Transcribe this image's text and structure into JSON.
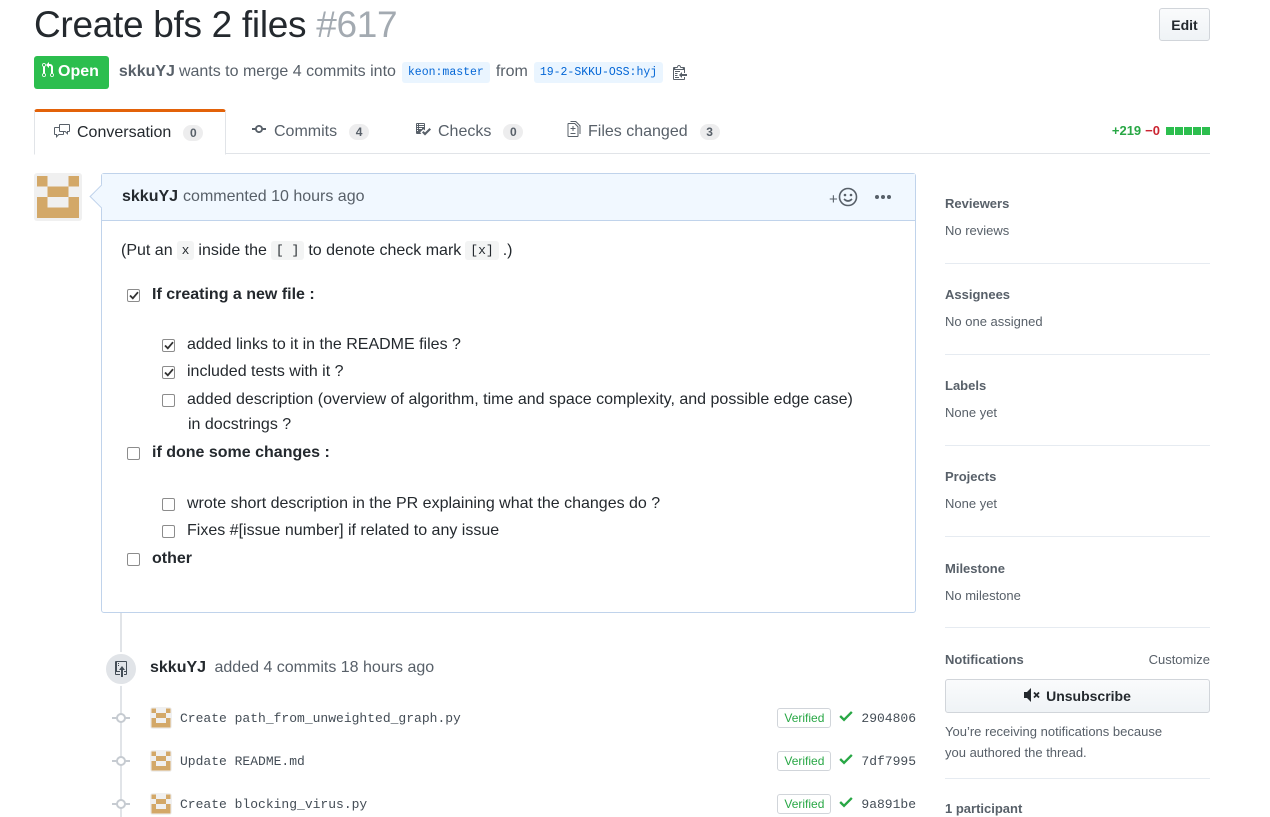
{
  "pr": {
    "title": "Create bfs 2 files",
    "number": "#617",
    "edit_label": "Edit",
    "state": "Open",
    "author": "skkuYJ",
    "merge_text": "wants to merge 4 commits into",
    "base_branch": "keon:master",
    "from_text": "from",
    "head_branch": "19-2-SKKU-OSS:hyj"
  },
  "tabs": [
    {
      "label": "Conversation",
      "count": "0",
      "icon": "comment-discussion-icon"
    },
    {
      "label": "Commits",
      "count": "4",
      "icon": "git-commit-icon"
    },
    {
      "label": "Checks",
      "count": "0",
      "icon": "checklist-icon"
    },
    {
      "label": "Files changed",
      "count": "3",
      "icon": "file-diff-icon"
    }
  ],
  "diffstat": {
    "additions": "+219",
    "deletions": "−0"
  },
  "comment": {
    "author": "skkuYJ",
    "action": "commented",
    "time": "10 hours ago",
    "intro_prefix": "(Put an",
    "intro_code1": "x",
    "intro_mid": "inside the",
    "intro_code2": "[ ]",
    "intro_mid2": "to denote check mark",
    "intro_code3": "[x]",
    "intro_suffix": ".)",
    "items": [
      {
        "text": "If creating a new file :",
        "checked": true,
        "bold": true
      },
      {
        "text": "added links to it in the README files ?",
        "checked": true,
        "bold": false
      },
      {
        "text": "included tests with it ?",
        "checked": true,
        "bold": false
      },
      {
        "text": "added description (overview of algorithm, time and space complexity, and possible edge case)",
        "text2": "in docstrings ?",
        "checked": false,
        "bold": false
      },
      {
        "text": "if done some changes :",
        "checked": false,
        "bold": true
      },
      {
        "text": "wrote short description in the PR explaining what the changes do ?",
        "checked": false,
        "bold": false
      },
      {
        "text": "Fixes #[issue number] if related to any issue",
        "checked": false,
        "bold": false
      },
      {
        "text": "other",
        "checked": false,
        "bold": true
      }
    ]
  },
  "push_event": {
    "author": "skkuYJ",
    "text": "added 4 commits 18 hours ago"
  },
  "commits": [
    {
      "message": "Create path_from_unweighted_graph.py",
      "verified": "Verified",
      "sha": "2904806"
    },
    {
      "message": "Update README.md",
      "verified": "Verified",
      "sha": "7df7995"
    },
    {
      "message": "Create blocking_virus.py",
      "verified": "Verified",
      "sha": "9a891be"
    }
  ],
  "sidebar": {
    "reviewers": {
      "heading": "Reviewers",
      "value": "No reviews"
    },
    "assignees": {
      "heading": "Assignees",
      "value": "No one assigned"
    },
    "labels": {
      "heading": "Labels",
      "value": "None yet"
    },
    "projects": {
      "heading": "Projects",
      "value": "None yet"
    },
    "milestone": {
      "heading": "Milestone",
      "value": "No milestone"
    },
    "notifications": {
      "heading": "Notifications",
      "customize": "Customize",
      "button": "Unsubscribe",
      "note_line1": "You’re receiving notifications because",
      "note_line2": "you authored the thread."
    },
    "participants": {
      "heading": "1 participant"
    }
  },
  "colors": {
    "open_green": "#2cbe4e",
    "verified_green": "#28a745",
    "link_blue": "#0366d6",
    "tab_accent": "#e36209"
  }
}
